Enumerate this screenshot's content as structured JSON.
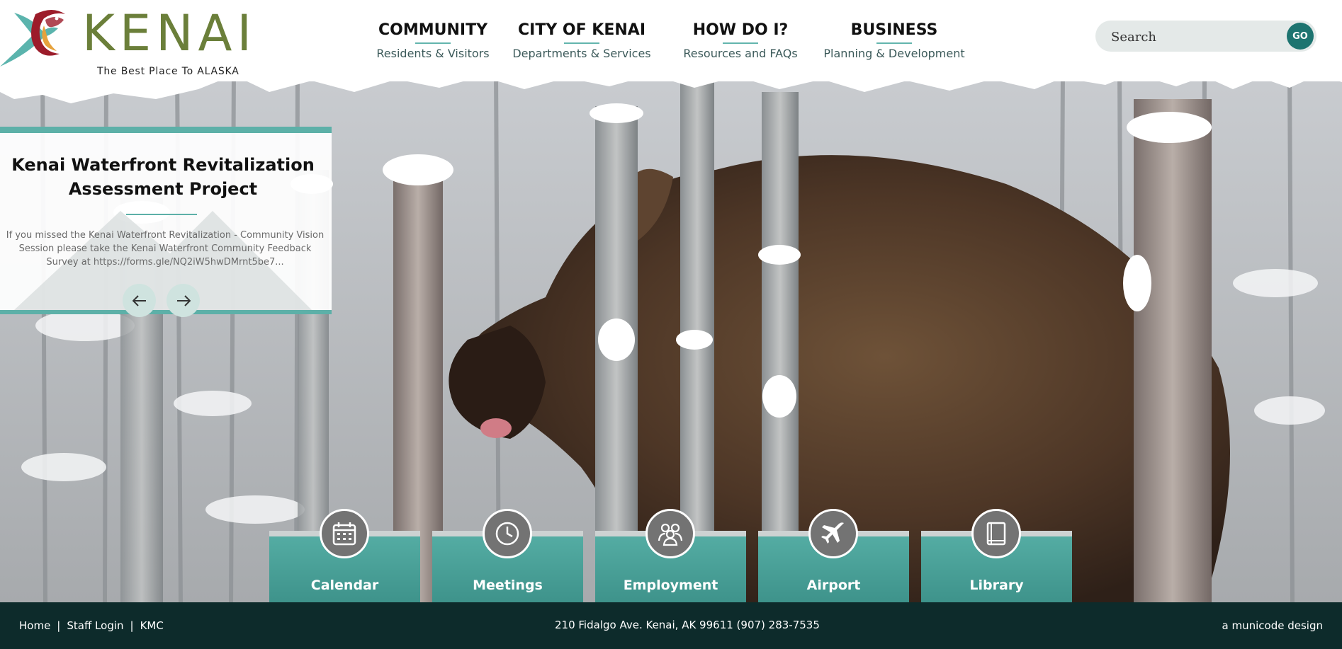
{
  "header": {
    "logo_text": "KENAI",
    "tagline": "The Best Place To ALASKA"
  },
  "nav": [
    {
      "title": "COMMUNITY",
      "subtitle": "Residents & Visitors"
    },
    {
      "title": "CITY OF KENAI",
      "subtitle": "Departments & Services"
    },
    {
      "title": "HOW DO I?",
      "subtitle": "Resources and FAQs"
    },
    {
      "title": "BUSINESS",
      "subtitle": "Planning & Development"
    }
  ],
  "search": {
    "placeholder": "Search",
    "button_label": "GO"
  },
  "slide": {
    "title": "Kenai Waterfront Revitalization Assessment Project",
    "text": "If you missed the Kenai Waterfront Revitalization - Community Vision Session please take the Kenai Waterfront Community Feedback Survey at https://forms.gle/NQ2iW5hwDMrnt5be7..."
  },
  "quick_links": [
    {
      "label": "Calendar",
      "icon": "calendar-icon"
    },
    {
      "label": "Meetings",
      "icon": "clock-icon"
    },
    {
      "label": "Employment",
      "icon": "people-icon"
    },
    {
      "label": "Airport",
      "icon": "airplane-icon"
    },
    {
      "label": "Library",
      "icon": "book-icon"
    }
  ],
  "footer": {
    "links": [
      "Home",
      "Staff Login",
      "KMC"
    ],
    "separator": "|",
    "address": "210 Fidalgo Ave. Kenai, AK 99611  (907) 283-7535",
    "credit": "a municode design"
  },
  "colors": {
    "brand_green": "#6b7f3a",
    "teal": "#5db0a8",
    "dark_teal": "#1d7470",
    "footer_bg": "#0d2b2b"
  }
}
